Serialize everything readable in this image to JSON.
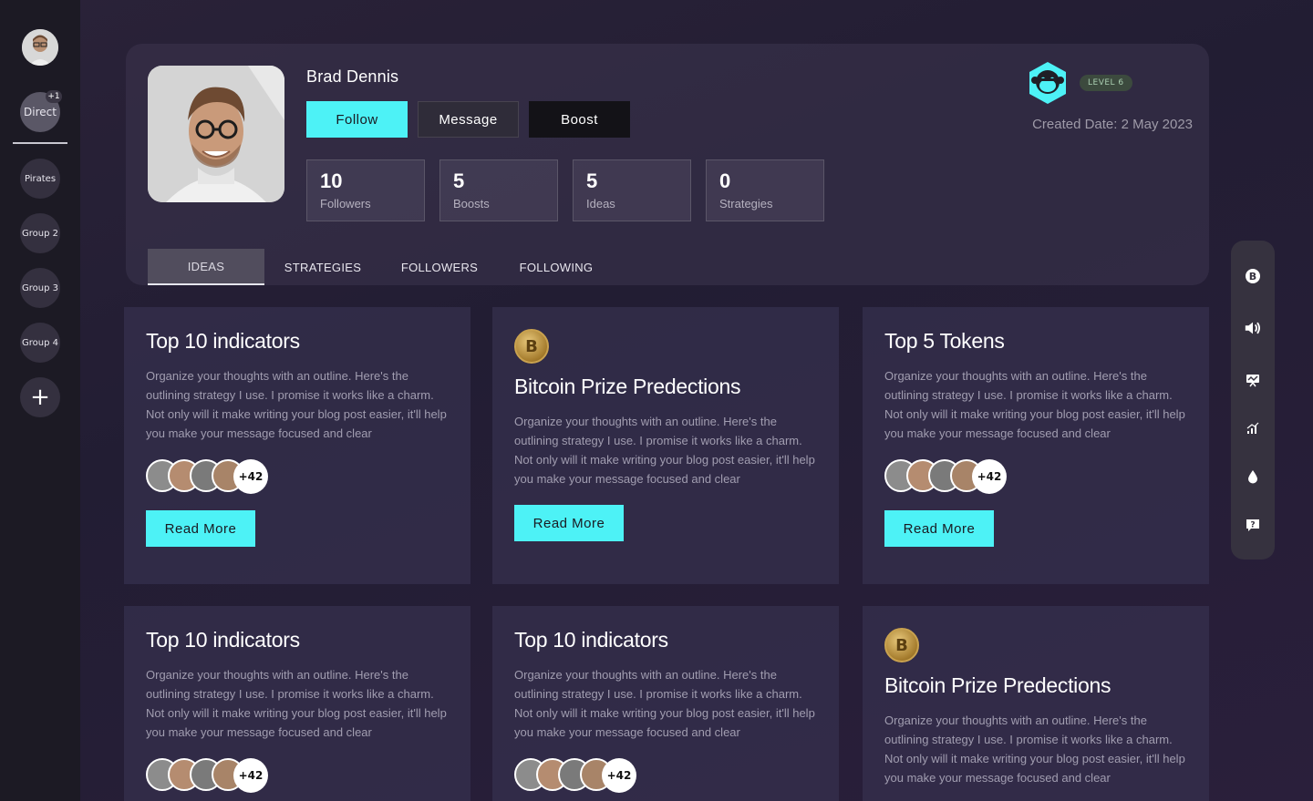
{
  "sidebar": {
    "direct_label": "Direct",
    "direct_badge": "+1",
    "groups": [
      "Pirates",
      "Group 2",
      "Group 3",
      "Group 4"
    ],
    "add_label": "+"
  },
  "profile": {
    "name": "Brad Dennis",
    "buttons": {
      "follow": "Follow",
      "message": "Message",
      "boost": "Boost"
    },
    "stats": [
      {
        "num": "10",
        "label": "Followers"
      },
      {
        "num": "5",
        "label": "Boosts"
      },
      {
        "num": "5",
        "label": "Ideas"
      },
      {
        "num": "0",
        "label": "Strategies"
      }
    ],
    "level": "LEVEL 6",
    "created": "Created Date: 2 May 2023",
    "tabs": [
      "IDEAS",
      "STRATEGIES",
      "FOLLOWERS",
      "FOLLOWING"
    ]
  },
  "cards": [
    {
      "title": "Top 10 indicators",
      "body": "Organize your thoughts with an outline. Here's the outlining strategy I use. I promise it works like a charm. Not only will it make writing your blog post easier, it'll help you make your message focused and clear",
      "more": "+42",
      "button": "Read More"
    },
    {
      "title": "Bitcoin Prize Predections",
      "body": "Organize your thoughts with an outline. Here's the outlining strategy I use. I promise it works like a charm. Not only will it make writing your blog post easier, it'll help you make your message focused and clear",
      "button": "Read More"
    },
    {
      "title": "Top 5 Tokens",
      "body": "Organize your thoughts with an outline. Here's the outlining strategy I use. I promise it works like a charm. Not only will it make writing your blog post easier, it'll help you make your message focused and clear",
      "more": "+42",
      "button": "Read More"
    },
    {
      "title": "Top 10 indicators",
      "body": "Organize your thoughts with an outline. Here's the outlining strategy I use. I promise it works like a charm. Not only will it make writing your blog post easier, it'll help you make your message focused and clear",
      "more": "+42"
    },
    {
      "title": "Top 10 indicators",
      "body": "Organize your thoughts with an outline. Here's the outlining strategy I use. I promise it works like a charm. Not only will it make writing your blog post easier, it'll help you make your message focused and clear",
      "more": "+42"
    },
    {
      "title": "Bitcoin Prize Predections",
      "body": "Organize your thoughts with an outline. Here's the outlining strategy I use. I promise it works like a charm. Not only will it make writing your blog post easier, it'll help you make your message focused and clear"
    }
  ],
  "colors": {
    "accent": "#4df2f6",
    "background": "#231e33",
    "card": "#36304e"
  },
  "icons": [
    "bitcoin-icon",
    "speaker-icon",
    "chart-board-icon",
    "signal-bars-icon",
    "drop-icon",
    "help-chat-icon"
  ]
}
